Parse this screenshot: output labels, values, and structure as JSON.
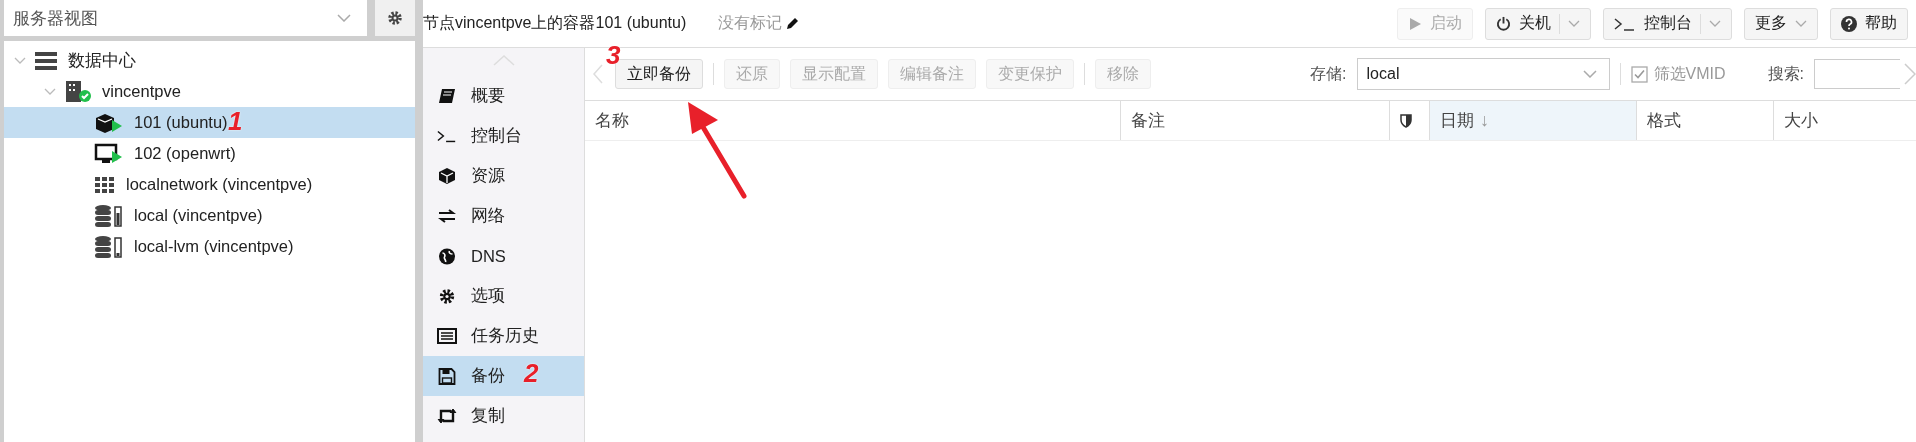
{
  "server_view": {
    "value": "服务器视图"
  },
  "tree": [
    {
      "label": "数据中心",
      "kind": "datacenter",
      "expanded": true,
      "selected": false,
      "children": [
        {
          "label": "vincentpve",
          "kind": "node",
          "expanded": true,
          "selected": false,
          "children": [
            {
              "label": "101 (ubuntu)",
              "kind": "container",
              "selected": true
            },
            {
              "label": "102 (openwrt)",
              "kind": "vm",
              "selected": false
            },
            {
              "label": "localnetwork (vincentpve)",
              "kind": "network",
              "selected": false
            },
            {
              "label": "local (vincentpve)",
              "kind": "storage",
              "selected": false
            },
            {
              "label": "local-lvm (vincentpve)",
              "kind": "lvm",
              "selected": false
            }
          ]
        }
      ]
    }
  ],
  "header": {
    "title": "节点vincentpve上的容器101 (ubuntu)",
    "tags": "没有标记"
  },
  "actions": [
    {
      "label": "启动",
      "kind": "start",
      "disabled": true
    },
    {
      "label": "关机",
      "kind": "shutdown",
      "disabled": false
    },
    {
      "label": "控制台",
      "kind": "console",
      "disabled": false
    },
    {
      "label": "更多",
      "kind": "more",
      "disabled": false
    },
    {
      "label": "帮助",
      "kind": "help",
      "disabled": false
    }
  ],
  "menu": [
    {
      "label": "概要",
      "kind": "summary",
      "selected": false
    },
    {
      "label": "控制台",
      "kind": "console",
      "selected": false
    },
    {
      "label": "资源",
      "kind": "resources",
      "selected": false
    },
    {
      "label": "网络",
      "kind": "network",
      "selected": false
    },
    {
      "label": "DNS",
      "kind": "dns",
      "selected": false
    },
    {
      "label": "选项",
      "kind": "options",
      "selected": false
    },
    {
      "label": "任务历史",
      "kind": "tasks",
      "selected": false
    },
    {
      "label": "备份",
      "kind": "backup",
      "selected": true
    },
    {
      "label": "复制",
      "kind": "replication",
      "selected": false
    }
  ],
  "toolbar": [
    {
      "label": "立即备份",
      "disabled": false
    },
    {
      "label": "还原",
      "disabled": true
    },
    {
      "label": "显示配置",
      "disabled": true
    },
    {
      "label": "编辑备注",
      "disabled": true
    },
    {
      "label": "变更保护",
      "disabled": true
    },
    {
      "label": "移除",
      "disabled": true
    }
  ],
  "storage": {
    "label": "存储:",
    "value": "local"
  },
  "filter_vmid": {
    "label": "筛选VMID",
    "checked": true
  },
  "search": {
    "label": "搜索:"
  },
  "columns": [
    {
      "label": "名称",
      "kind": "text",
      "sorted": false
    },
    {
      "label": "备注",
      "kind": "text",
      "sorted": false
    },
    {
      "kind": "shield",
      "sorted": false
    },
    {
      "label": "日期",
      "kind": "text",
      "sorted": true,
      "sort_arrow": "↓"
    },
    {
      "label": "格式",
      "kind": "text",
      "sorted": false
    },
    {
      "label": "大小",
      "kind": "text",
      "sorted": false
    }
  ],
  "annotations": [
    "1",
    "2",
    "3"
  ]
}
